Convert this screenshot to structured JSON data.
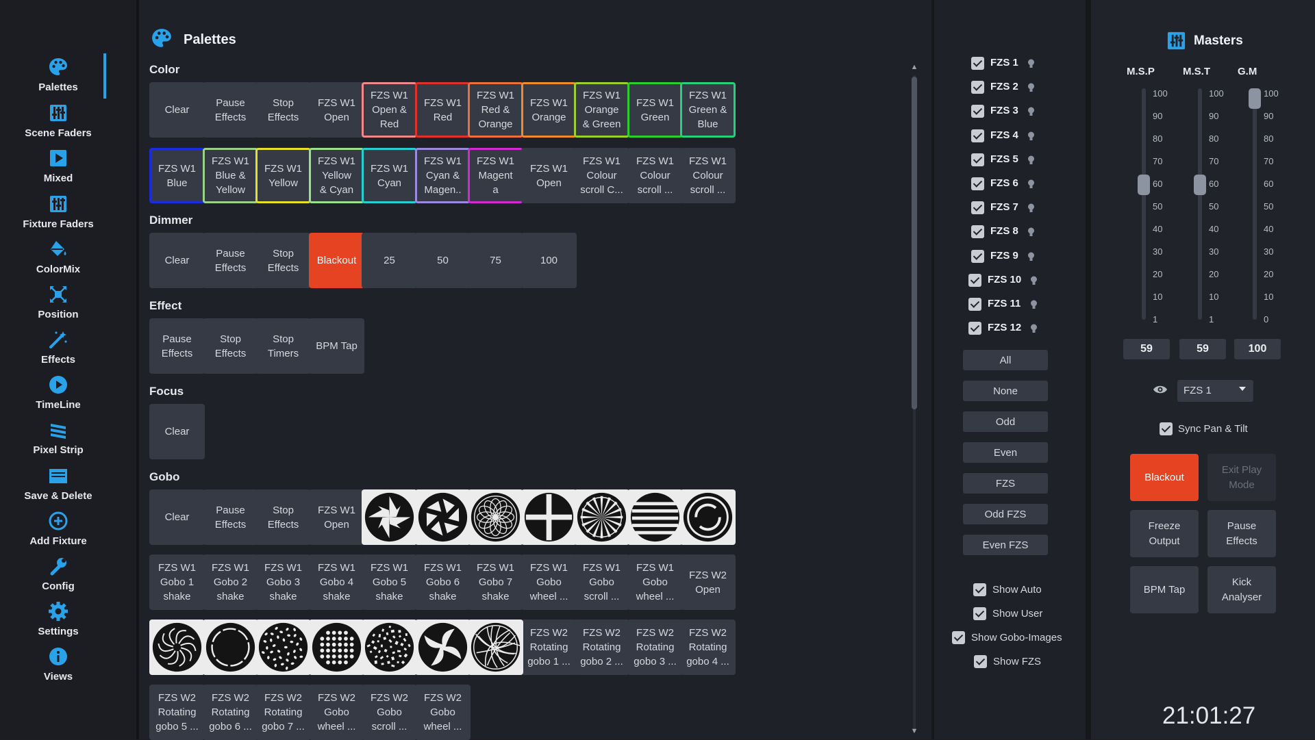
{
  "nav": {
    "items": [
      {
        "label": "Palettes",
        "icon": "palette-icon"
      },
      {
        "label": "Scene Faders",
        "icon": "faders-icon"
      },
      {
        "label": "Mixed",
        "icon": "play-icon"
      },
      {
        "label": "Fixture Faders",
        "icon": "faders-icon"
      },
      {
        "label": "ColorMix",
        "icon": "paint-bucket-icon"
      },
      {
        "label": "Position",
        "icon": "position-icon"
      },
      {
        "label": "Effects",
        "icon": "magic-wand-icon"
      },
      {
        "label": "TimeLine",
        "icon": "play-circle-icon"
      },
      {
        "label": "Pixel Strip",
        "icon": "pixel-strip-icon"
      },
      {
        "label": "Save & Delete",
        "icon": "save-icon"
      },
      {
        "label": "Add Fixture",
        "icon": "plus-circle-icon"
      },
      {
        "label": "Config",
        "icon": "wrench-icon"
      },
      {
        "label": "Settings",
        "icon": "gear-icon"
      },
      {
        "label": "Views",
        "icon": "info-icon"
      }
    ],
    "active": "Palettes"
  },
  "palettes": {
    "title": "Palettes",
    "sections": {
      "color": "Color",
      "dimmer": "Dimmer",
      "effect": "Effect",
      "focus": "Focus",
      "gobo": "Gobo"
    },
    "color_tiles": [
      {
        "label": "Clear"
      },
      {
        "label": "Pause\nEffects"
      },
      {
        "label": "Stop\nEffects"
      },
      {
        "label": "FZS W1\nOpen"
      },
      {
        "label": "FZS W1\nOpen &\nRed",
        "border": "#f08a8a"
      },
      {
        "label": "FZS W1\nRed",
        "border": "#e0302a"
      },
      {
        "label": "FZS W1\nRed &\nOrange",
        "border": "#ef6f3a"
      },
      {
        "label": "FZS W1\nOrange",
        "border": "#f08a2a"
      },
      {
        "label": "FZS W1\nOrange\n& Green",
        "border": "#9bd02a"
      },
      {
        "label": "FZS W1\nGreen",
        "border": "#27d02a"
      },
      {
        "label": "FZS W1\nGreen &\nBlue",
        "border": "#27d07a"
      },
      {
        "label": "FZS W1\nBlue",
        "border": "#1a2be0"
      },
      {
        "label": "FZS W1\nBlue &\nYellow",
        "border": "#9bd08a"
      },
      {
        "label": "FZS W1\nYellow",
        "border": "#e6e02a"
      },
      {
        "label": "FZS W1\nYellow\n& Cyan",
        "border": "#9be08a"
      },
      {
        "label": "FZS W1\nCyan",
        "border": "#27d0d0"
      },
      {
        "label": "FZS W1\nCyan &\nMagen..",
        "border": "#9b8ae0"
      },
      {
        "label": "FZS W1\nMagent\na",
        "border": "#d02ad0"
      },
      {
        "label": "FZS W1\nOpen"
      },
      {
        "label": "FZS W1\nColour\nscroll C..."
      },
      {
        "label": "FZS W1\nColour\nscroll ..."
      },
      {
        "label": "FZS W1\nColour\nscroll ..."
      }
    ],
    "dimmer_tiles": [
      "Clear",
      "Pause\nEffects",
      "Stop\nEffects",
      "Blackout",
      "25",
      "50",
      "75",
      "100"
    ],
    "effect_tiles": [
      "Pause\nEffects",
      "Stop\nEffects",
      "Stop\nTimers",
      "BPM Tap"
    ],
    "focus_tiles": [
      "Clear"
    ],
    "gobo_text_row1": [
      "Clear",
      "Pause\nEffects",
      "Stop\nEffects",
      "FZS W1\nOpen"
    ],
    "gobo_images_row1": [
      "gobo-star-icon",
      "gobo-shutter-icon",
      "gobo-rosette-icon",
      "gobo-cross-icon",
      "gobo-starburst-icon",
      "gobo-stripes-icon",
      "gobo-swirl-ring-icon"
    ],
    "gobo_text_row2": [
      "FZS W1\nGobo 1\nshake",
      "FZS W1\nGobo 2\nshake",
      "FZS W1\nGobo 3\nshake",
      "FZS W1\nGobo 4\nshake",
      "FZS W1\nGobo 5\nshake",
      "FZS W1\nGobo 6\nshake",
      "FZS W1\nGobo 7\nshake",
      "FZS W1\nGobo\nwheel ...",
      "FZS W1\nGobo\nscroll ...",
      "FZS W1\nGobo\nwheel ...",
      "FZS W2\nOpen"
    ],
    "gobo_images_row3": [
      "gobo-spiral-icon",
      "gobo-ring-icon",
      "gobo-cells-icon",
      "gobo-dots-icon",
      "gobo-breakup-icon",
      "gobo-fan-icon",
      "gobo-web-icon"
    ],
    "gobo_text_row3": [
      "FZS W2\nRotating\ngobo 1 ...",
      "FZS W2\nRotating\ngobo 2 ...",
      "FZS W2\nRotating\ngobo 3 ...",
      "FZS W2\nRotating\ngobo 4 ..."
    ],
    "gobo_text_row4": [
      "FZS W2\nRotating\ngobo 5 ...",
      "FZS W2\nRotating\ngobo 6 ...",
      "FZS W2\nRotating\ngobo 7 ...",
      "FZS W2\nGobo\nwheel ...",
      "FZS W2\nGobo\nscroll ...",
      "FZS W2\nGobo\nwheel ..."
    ]
  },
  "fixtures": {
    "items": [
      "FZS 1",
      "FZS 2",
      "FZS 3",
      "FZS 4",
      "FZS 5",
      "FZS 6",
      "FZS 7",
      "FZS 8",
      "FZS 9",
      "FZS 10",
      "FZS 11",
      "FZS 12"
    ],
    "selectors": [
      "All",
      "None",
      "Odd",
      "Even",
      "FZS",
      "Odd FZS",
      "Even FZS"
    ],
    "options": [
      "Show Auto",
      "Show User",
      "Show Gobo-Images",
      "Show FZS"
    ]
  },
  "masters": {
    "title": "Masters",
    "faders": [
      {
        "name": "M.S.P",
        "value": "59",
        "level": 59,
        "ticks": [
          "100",
          "90",
          "80",
          "70",
          "60",
          "50",
          "40",
          "30",
          "20",
          "10",
          "1"
        ]
      },
      {
        "name": "M.S.T",
        "value": "59",
        "level": 59,
        "ticks": [
          "100",
          "90",
          "80",
          "70",
          "60",
          "50",
          "40",
          "30",
          "20",
          "10",
          "1"
        ]
      },
      {
        "name": "G.M",
        "value": "100",
        "level": 100,
        "ticks": [
          "100",
          "90",
          "80",
          "70",
          "60",
          "50",
          "40",
          "30",
          "20",
          "10",
          "0"
        ]
      }
    ],
    "fixture_select": "FZS 1",
    "sync_label": "Sync Pan & Tilt",
    "buttons": [
      {
        "label": "Blackout",
        "style": "red"
      },
      {
        "label": "Exit Play\nMode",
        "style": "disabled"
      },
      {
        "label": "Freeze\nOutput"
      },
      {
        "label": "Pause\nEffects"
      },
      {
        "label": "BPM Tap"
      },
      {
        "label": "Kick\nAnalyser"
      }
    ],
    "clock": "21:01:27"
  }
}
